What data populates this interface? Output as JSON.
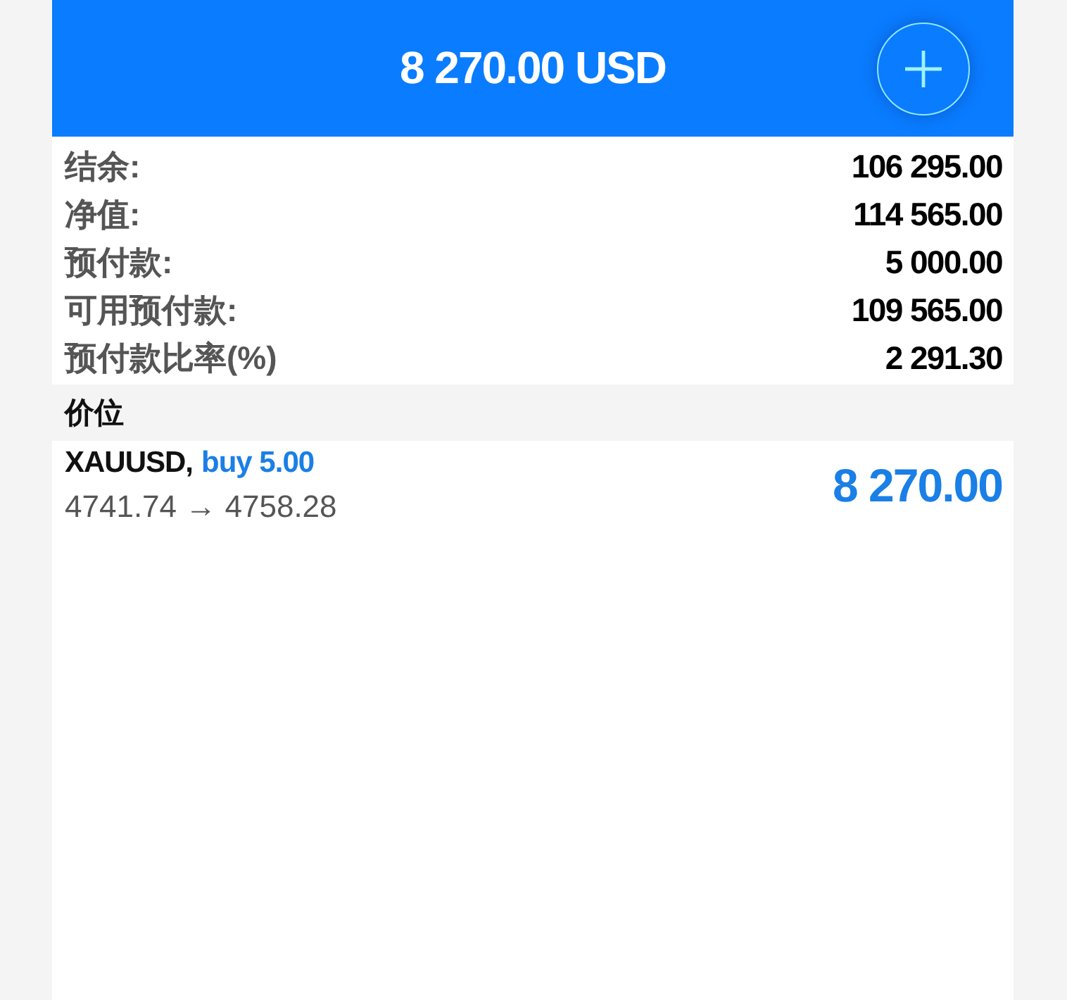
{
  "header": {
    "title": "8 270.00 USD"
  },
  "summary": [
    {
      "label": "结余:",
      "value": "106 295.00"
    },
    {
      "label": "净值:",
      "value": "114 565.00"
    },
    {
      "label": "预付款:",
      "value": "5 000.00"
    },
    {
      "label": "可用预付款:",
      "value": "109 565.00"
    },
    {
      "label": "预付款比率(%)",
      "value": "2 291.30"
    }
  ],
  "section": {
    "title": "价位"
  },
  "positions": [
    {
      "symbol": "XAUUSD,",
      "order": "buy 5.00",
      "prices": "4741.74 → 4758.28",
      "profit": "8 270.00"
    }
  ]
}
